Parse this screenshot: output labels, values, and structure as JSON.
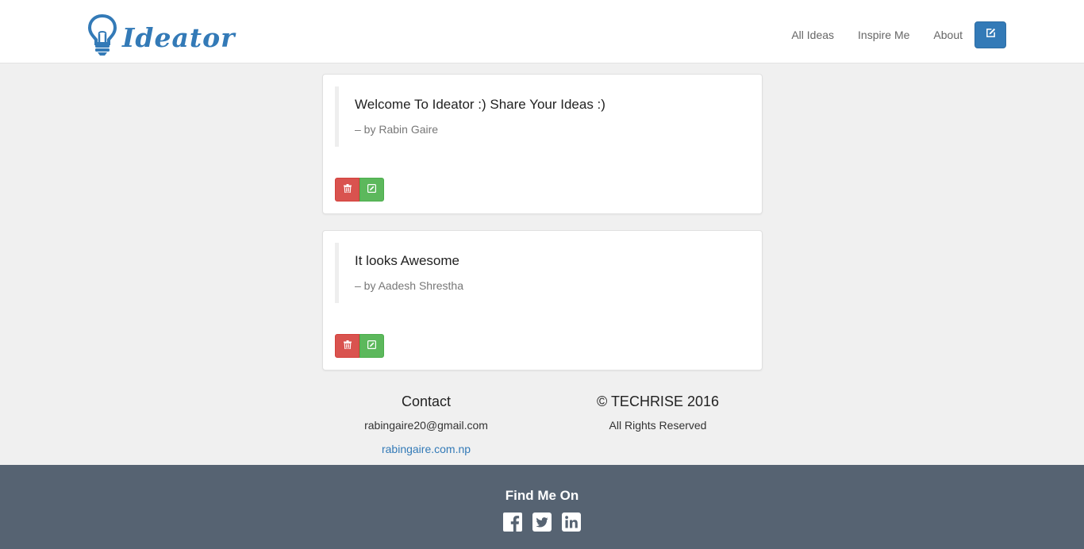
{
  "brand": {
    "name": "Ideator",
    "logo_icon": "lightbulb-icon"
  },
  "nav": {
    "links": [
      "All Ideas",
      "Inspire Me",
      "About"
    ],
    "new_idea_icon": "edit-icon"
  },
  "ideas": [
    {
      "text": "Welcome To Ideator :) Share Your Ideas :)",
      "author": "– by Rabin Gaire"
    },
    {
      "text": "It looks Awesome",
      "author": "– by Aadesh Shrestha"
    }
  ],
  "info": {
    "contact_title": "Contact",
    "email": "rabingaire20@gmail.com",
    "website": "rabingaire.com.np",
    "copyright": "© TECHRISE 2016",
    "rights": "All Rights Reserved"
  },
  "footer": {
    "title": "Find Me On",
    "social_icons": [
      "facebook-icon",
      "twitter-icon",
      "linkedin-icon"
    ]
  },
  "colors": {
    "primary": "#337ab7",
    "danger": "#d9534f",
    "success": "#5cb85c",
    "footer_bg": "#566372",
    "page_bg": "#f0f0f0"
  }
}
